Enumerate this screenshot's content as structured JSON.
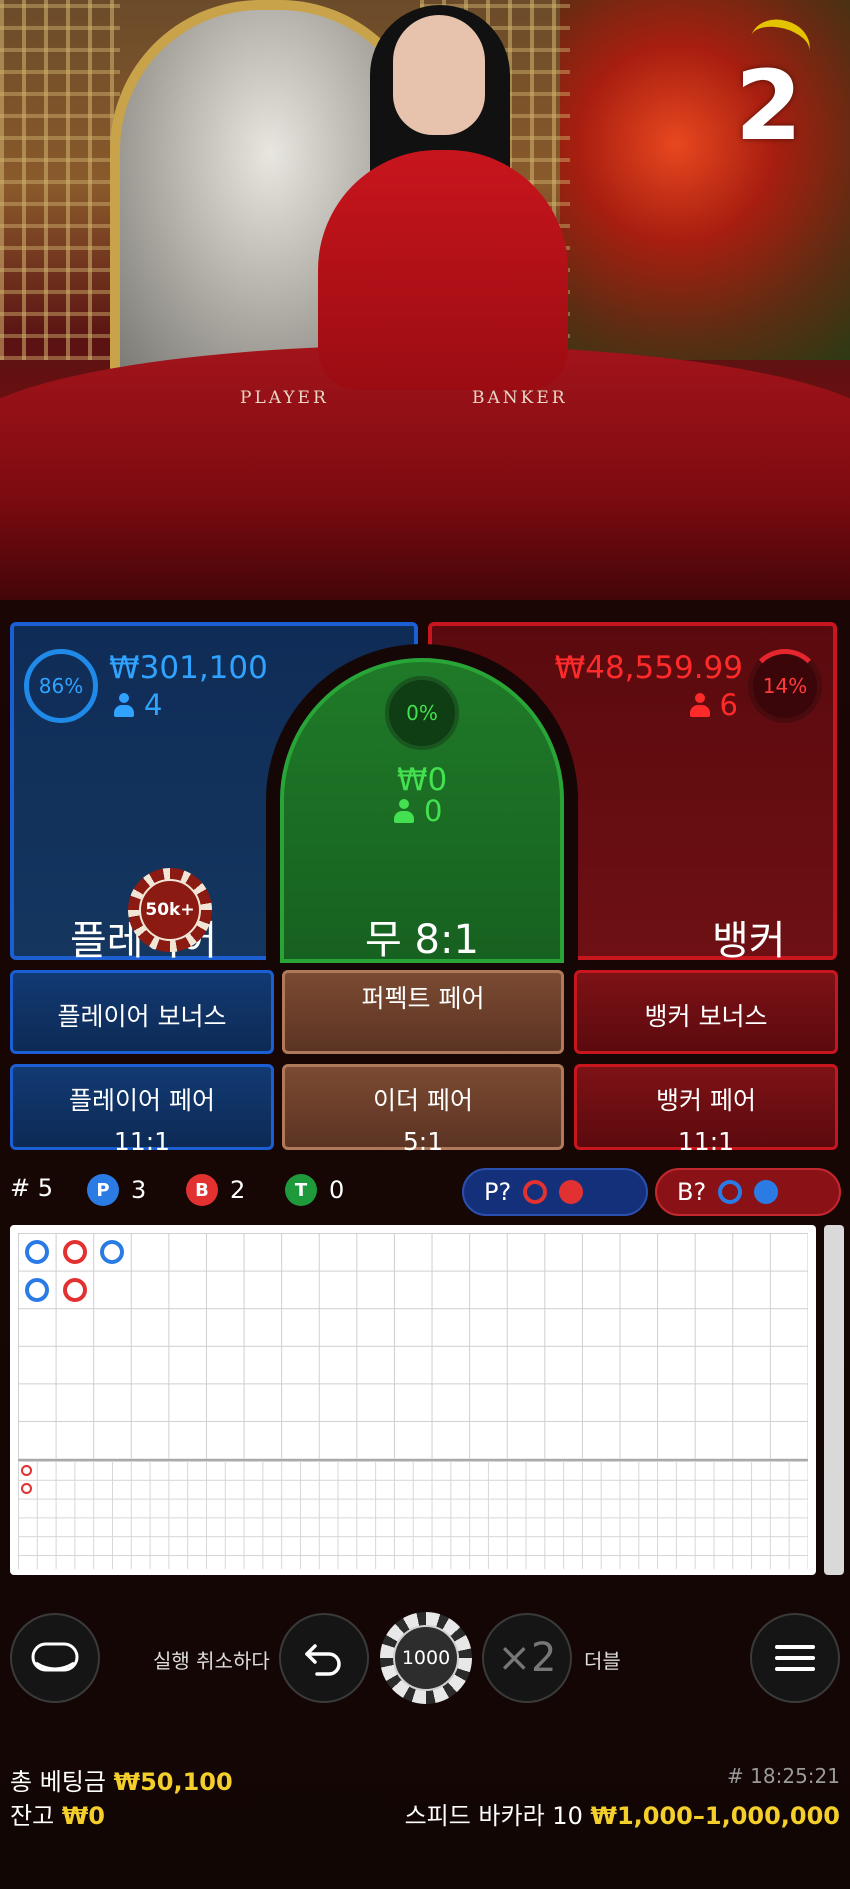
{
  "video": {
    "felt_player": "PLAYER",
    "felt_banker": "BANKER",
    "countdown": "2"
  },
  "player_spot": {
    "percent": "86%",
    "amount": "₩301,100",
    "count": "4",
    "label": "플레이어",
    "chip": "50k+",
    "color": "#1b5fd3"
  },
  "tie_spot": {
    "percent": "0%",
    "amount": "₩0",
    "count": "0",
    "label": "무 8:1",
    "color": "#28a536"
  },
  "banker_spot": {
    "percent": "14%",
    "amount": "₩48,559.99",
    "count": "6",
    "label": "뱅커",
    "color": "#c8161e"
  },
  "side_bets": {
    "player_bonus": "플레이어 보너스",
    "perfect_pair": "퍼펙트 페어",
    "banker_bonus": "뱅커 보너스",
    "player_pair": "플레이어 페어",
    "player_pair_odds": "11:1",
    "either_pair": "이더 페어",
    "either_pair_odds": "5:1",
    "banker_pair": "뱅커 페어",
    "banker_pair_odds": "11:1"
  },
  "stats": {
    "rounds": "# 5",
    "p_badge": "P",
    "p_count": "3",
    "b_badge": "B",
    "b_count": "2",
    "t_badge": "T",
    "t_count": "0",
    "p_predict": "P?",
    "b_predict": "B?"
  },
  "controls": {
    "undo_label": "실행 취소하다",
    "chip_value": "1000",
    "double_symbol": "×2",
    "double_label": "더블"
  },
  "footer": {
    "total_bet_label": "총 베팅금",
    "total_bet_value": "₩50,100",
    "balance_label": "잔고",
    "balance_value": "₩0",
    "round_id": "# 18:25:21",
    "table_name": "스피드 바카라 10",
    "limits": "₩1,000–1,000,000"
  }
}
